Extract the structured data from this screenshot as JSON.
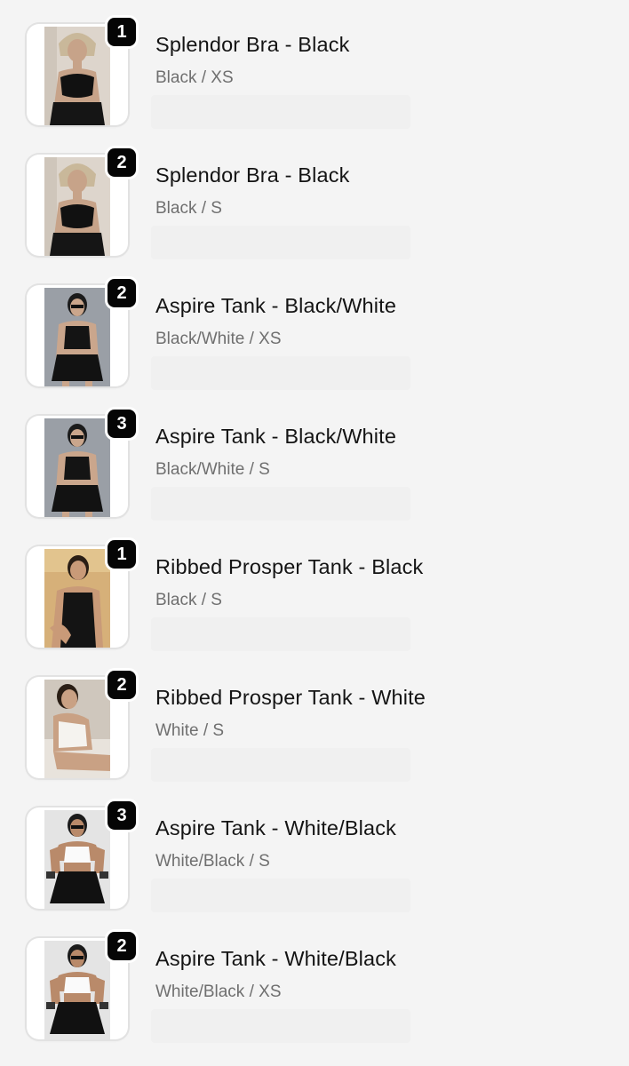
{
  "cart": {
    "items": [
      {
        "quantity": "1",
        "title": "Splendor Bra - Black",
        "variant": "Black / XS",
        "image": "model-black-sports-bra-photo"
      },
      {
        "quantity": "2",
        "title": "Splendor Bra - Black",
        "variant": "Black / S",
        "image": "model-black-sports-bra-photo"
      },
      {
        "quantity": "2",
        "title": "Aspire Tank - Black/White",
        "variant": "Black/White / XS",
        "image": "model-black-tank-photo"
      },
      {
        "quantity": "3",
        "title": "Aspire Tank - Black/White",
        "variant": "Black/White / S",
        "image": "model-black-tank-photo"
      },
      {
        "quantity": "1",
        "title": "Ribbed Prosper Tank - Black",
        "variant": "Black / S",
        "image": "model-ribbed-black-tank-photo"
      },
      {
        "quantity": "2",
        "title": "Ribbed Prosper Tank - White",
        "variant": "White / S",
        "image": "model-ribbed-white-tank-photo"
      },
      {
        "quantity": "3",
        "title": "Aspire Tank - White/Black",
        "variant": "White/Black / S",
        "image": "model-white-tank-photo"
      },
      {
        "quantity": "2",
        "title": "Aspire Tank - White/Black",
        "variant": "White/Black / XS",
        "image": "model-white-tank-photo"
      }
    ]
  },
  "colors": {
    "background": "#f4f4f4",
    "badge": "#050505",
    "title": "#141414",
    "variant": "#6f6f6f"
  }
}
